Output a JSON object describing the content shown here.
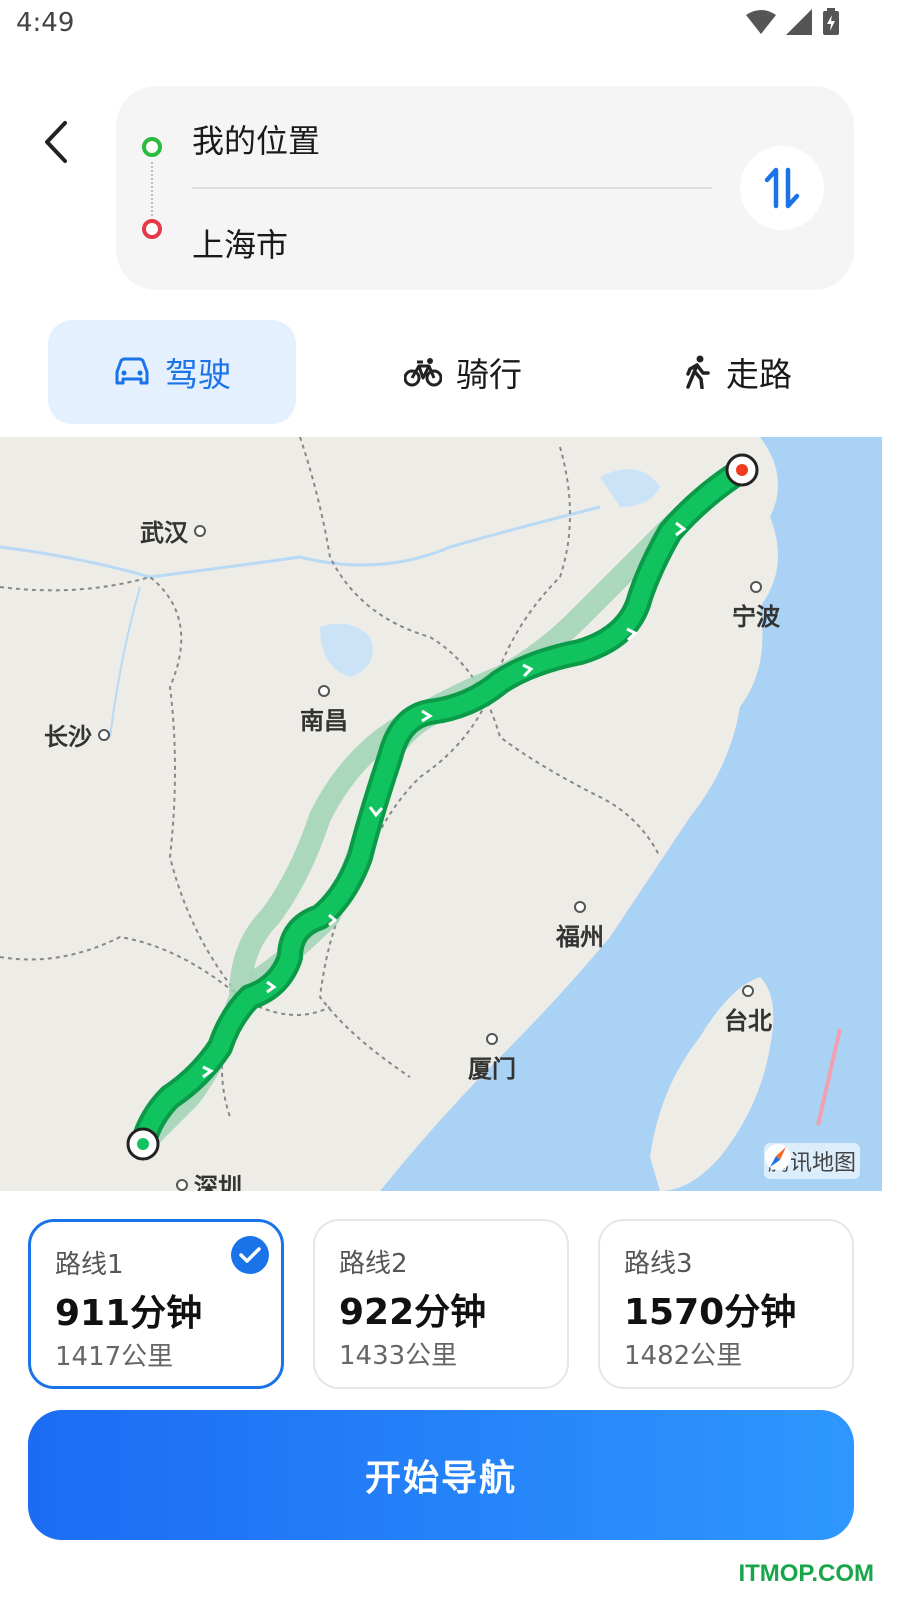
{
  "status_bar": {
    "time": "4:49"
  },
  "search": {
    "origin": "我的位置",
    "destination": "上海市"
  },
  "modes": [
    {
      "label": "驾驶",
      "icon": "car-icon",
      "active": true
    },
    {
      "label": "骑行",
      "icon": "bicycle-icon",
      "active": false
    },
    {
      "label": "走路",
      "icon": "walk-icon",
      "active": false
    }
  ],
  "map": {
    "cities": [
      "武汉",
      "长沙",
      "南昌",
      "宁波",
      "福州",
      "台北",
      "厦门",
      "深圳"
    ],
    "attribution": "腾讯地图"
  },
  "routes": [
    {
      "name": "路线1",
      "time": "911分钟",
      "distance": "1417公里",
      "selected": true
    },
    {
      "name": "路线2",
      "time": "922分钟",
      "distance": "1433公里",
      "selected": false
    },
    {
      "name": "路线3",
      "time": "1570分钟",
      "distance": "1482公里",
      "selected": false
    }
  ],
  "navigate_label": "开始导航",
  "site_mark": "ITMOP.COM",
  "colors": {
    "accent": "#1a73e8",
    "route": "#0fbf5a",
    "alt_route": "#9fd3b4",
    "water": "#a9d2f5"
  }
}
